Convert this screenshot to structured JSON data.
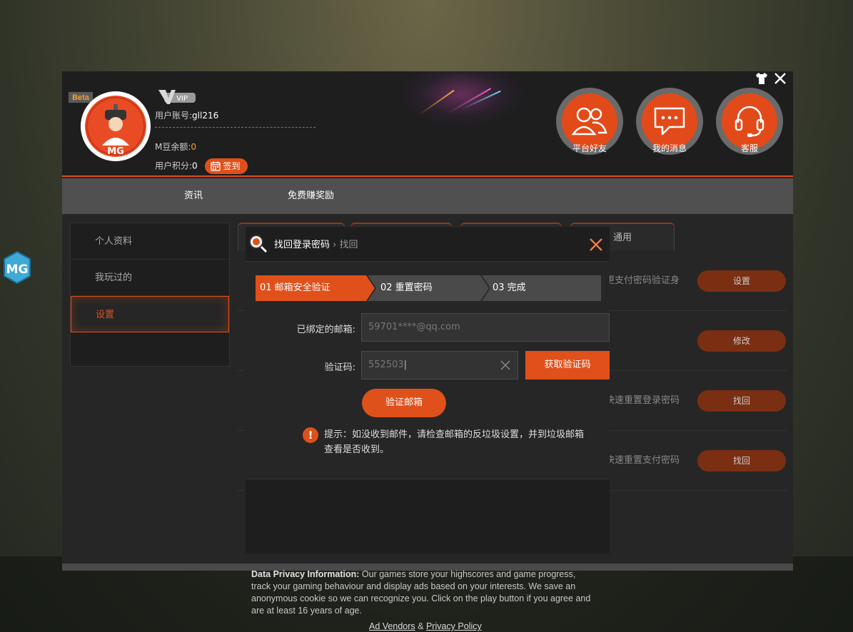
{
  "header": {
    "beta": "Beta",
    "vip": "VIP",
    "account_label": "用户账号:",
    "account_value": "gll216",
    "balance_label": "M豆余额:",
    "balance_value": "0",
    "points_label": "用户积分:",
    "points_value": "0",
    "sign_label": "签到",
    "buttons": [
      {
        "label": "平台好友",
        "icon": "friends-icon"
      },
      {
        "label": "我的消息",
        "icon": "message-icon"
      },
      {
        "label": "客服",
        "icon": "headset-icon"
      }
    ]
  },
  "nav": {
    "items": [
      "资讯",
      "免费赚奖励"
    ]
  },
  "sidebar": {
    "items": [
      "个人资料",
      "我玩过的",
      "设置"
    ]
  },
  "content": {
    "tab_general": "通用",
    "rows": [
      {
        "desc": "更支付密码验证身",
        "button": "设置"
      },
      {
        "desc": "",
        "button": "修改"
      },
      {
        "desc": "快速重置登录密码",
        "button": "找回"
      },
      {
        "desc": "快速重置支付密码",
        "button": "找回"
      }
    ]
  },
  "dialog": {
    "title": "找回登录密码",
    "crumb_sep": "›",
    "crumb": "找回",
    "steps": [
      "01 邮箱安全验证",
      "02 重置密码",
      "03 完成"
    ],
    "email_label": "已绑定的邮箱:",
    "email_value": "59701****@qq.com",
    "code_label": "验证码:",
    "code_value": "552503",
    "get_code_button": "获取验证码",
    "verify_button": "验证邮箱",
    "tip": "提示：如没收到邮件，请检查邮箱的反垃圾设置，并到垃圾邮箱查看是否收到。"
  },
  "privacy": {
    "heading": "Data Privacy Information:",
    "text": " Our games store your highscores and game progress, track your gaming behaviour and display ads based on your interests. We save an anonymous cookie so we can recognize you. Click on the play button if you agree and are at least 16 years of age.",
    "link1": "Ad Vendors",
    "amp": " & ",
    "link2": "Privacy Policy"
  },
  "colors": {
    "accent": "#e0501a",
    "panel": "#1e1e1e",
    "nav": "#505050"
  }
}
